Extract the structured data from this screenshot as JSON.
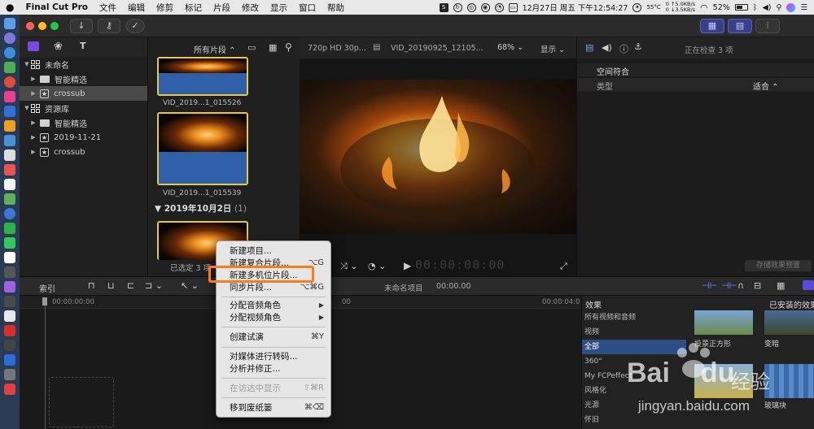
{
  "menubar": {
    "app_name": "Final Cut Pro",
    "items": [
      "文件",
      "编辑",
      "修剪",
      "标记",
      "片段",
      "修改",
      "显示",
      "窗口",
      "帮助"
    ],
    "battery": "52%",
    "datetime": "12月27日 周五 下午12:54:27",
    "temp": "55°C",
    "net_up": "5.0KB/s",
    "net_down": "3.5KB/s",
    "net_up_prefix": "0",
    "net_down_prefix": "0"
  },
  "library": {
    "browser_filter": "所有片段",
    "items": [
      {
        "label": "未命名",
        "type": "library"
      },
      {
        "label": "智能精选",
        "type": "folder"
      },
      {
        "label": "crossub",
        "type": "event",
        "selected": true
      },
      {
        "label": "资源库",
        "type": "library"
      },
      {
        "label": "智能精选",
        "type": "folder"
      },
      {
        "label": "2019-11-21",
        "type": "event"
      },
      {
        "label": "crossub",
        "type": "event"
      }
    ]
  },
  "browser": {
    "clips": [
      {
        "caption": "VID_2019...1_015526"
      },
      {
        "caption": "VID_2019...1_015539"
      }
    ],
    "date_header": "2019年10月2日",
    "date_count": "(1)",
    "selection_status": "已选定 3 项"
  },
  "viewer": {
    "format": "720p HD 30p...",
    "clip_name": "VID_20190925_12105...",
    "zoom": "68%",
    "display": "显示",
    "timecode": "00:00:00:00"
  },
  "inspector": {
    "title": "正在检查 3 项",
    "section": "空间符合",
    "type_label": "类型",
    "type_value": "适合",
    "save_preset": "存储效果预置"
  },
  "timeline": {
    "index_label": "索引",
    "project_name": "未命名项目",
    "project_time": "00:00.00",
    "ruler_start": "00:00:00:00",
    "ruler_mid": "00",
    "ruler_end": "00:00:04:0"
  },
  "effects": {
    "title": "效果",
    "installed": "已安装的效果",
    "categories": [
      {
        "label": "所有视频和音频",
        "selected": false
      },
      {
        "label": "视频",
        "selected": false
      },
      {
        "label": "全部",
        "selected": true
      },
      {
        "label": "360°",
        "selected": false
      },
      {
        "label": "My FCPeffect",
        "selected": false
      },
      {
        "label": "风格化",
        "selected": false
      },
      {
        "label": "光源",
        "selected": false
      },
      {
        "label": "怀旧",
        "selected": false
      }
    ],
    "thumbs": [
      {
        "label": "投景正方形"
      },
      {
        "label": "变暗"
      },
      {
        "label": ""
      },
      {
        "label": "玻璃块"
      }
    ]
  },
  "context_menu": {
    "items": [
      {
        "label": "新建项目...",
        "shortcut": "",
        "disabled": false
      },
      {
        "label": "新建复合片段...",
        "shortcut": "⌥G",
        "disabled": false
      },
      {
        "label": "新建多机位片段...",
        "shortcut": "",
        "disabled": false
      },
      {
        "label": "同步片段...",
        "shortcut": "⌥⌘G",
        "disabled": false
      },
      {
        "label": "分配音频角色",
        "shortcut": "▶",
        "disabled": false
      },
      {
        "label": "分配视频角色",
        "shortcut": "▶",
        "disabled": false
      },
      {
        "label": "创建试演",
        "shortcut": "⌘Y",
        "disabled": false
      },
      {
        "label": "对媒体进行转码...",
        "shortcut": "",
        "disabled": false
      },
      {
        "label": "分析并修正...",
        "shortcut": "",
        "disabled": false
      },
      {
        "label": "在访达中显示",
        "shortcut": "⇧⌘R",
        "disabled": true
      },
      {
        "label": "移到废纸篓",
        "shortcut": "⌘⌫",
        "disabled": false
      }
    ]
  },
  "watermark": {
    "brand": "Bai",
    "brand2": "du",
    "suffix": "经验",
    "url": "jingyan.baidu.com"
  },
  "colors": {
    "selection_orange": "#ff7a1a",
    "clip_border": "#e8c84a",
    "effects_selected": "#2d4f86"
  }
}
